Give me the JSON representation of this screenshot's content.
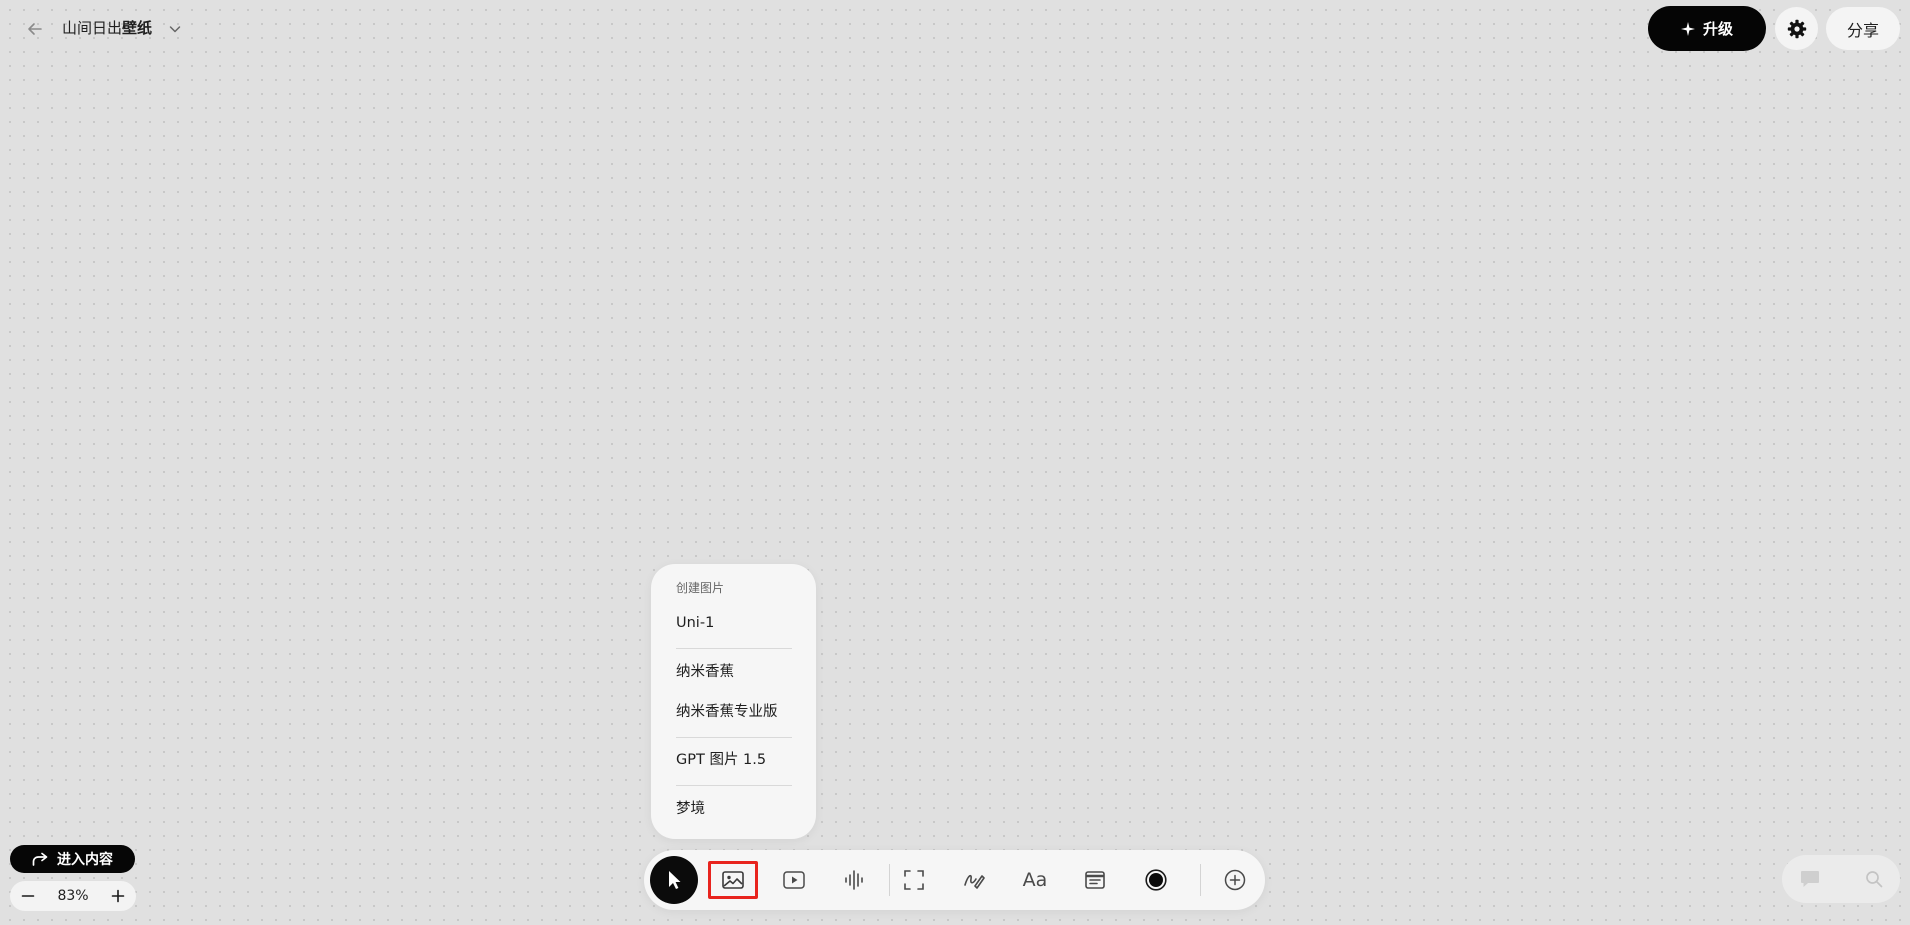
{
  "header": {
    "title_prefix": "山间日出",
    "title_bold": "壁纸",
    "upgrade_label": "升级",
    "share_label": "分享"
  },
  "menu": {
    "header": "创建图片",
    "items": [
      {
        "label": "Uni-1"
      },
      {
        "label": "纳米香蕉"
      },
      {
        "label": "纳米香蕉专业版"
      },
      {
        "label": "GPT 图片 1.5"
      },
      {
        "label": "梦境"
      }
    ]
  },
  "toolbar": {
    "tools": [
      {
        "icon": "cursor-icon",
        "state": "active"
      },
      {
        "icon": "image-icon",
        "state": "highlighted"
      },
      {
        "icon": "video-icon"
      },
      {
        "icon": "audio-waveform-icon"
      },
      {
        "icon": "frame-icon"
      },
      {
        "icon": "draw-icon"
      },
      {
        "icon": "text-icon",
        "label": "Aa"
      },
      {
        "icon": "note-icon"
      },
      {
        "icon": "color-dot-icon"
      },
      {
        "icon": "add-circle-icon"
      }
    ],
    "highlight_color": "#e8241e"
  },
  "footer": {
    "enter_label": "进入内容",
    "zoom_value": "83%"
  },
  "colors": {
    "canvas": "#e0e0e0",
    "accent_dark": "#050505",
    "panel": "#f6f6f6"
  }
}
